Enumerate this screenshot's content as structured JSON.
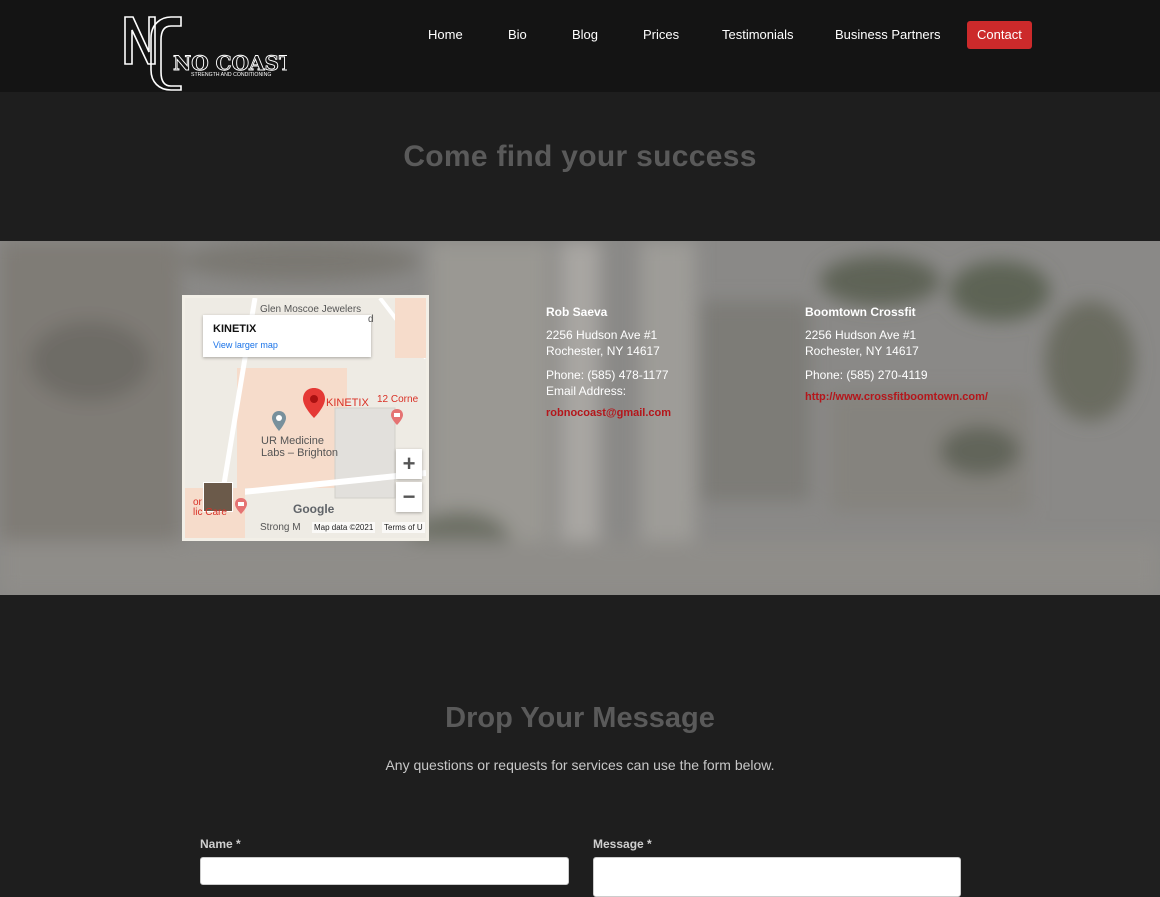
{
  "header": {
    "logo": {
      "big_letters": "NC",
      "word": "NO COAST",
      "tagline": "STRENGTH AND CONDITIONING"
    },
    "nav": [
      {
        "label": "Home"
      },
      {
        "label": "Bio"
      },
      {
        "label": "Blog"
      },
      {
        "label": "Prices"
      },
      {
        "label": "Testimonials"
      },
      {
        "label": "Business Partners"
      },
      {
        "label": "Contact"
      }
    ]
  },
  "hero": {
    "title": "Come find your success"
  },
  "map": {
    "place_name": "KINETIX",
    "view_larger": "View larger map",
    "marker_label": "KINETIX",
    "labels": {
      "top": "Glen Moscoe Jewelers",
      "top_suffix": "d",
      "corner": "12 Corne",
      "ur_medicine": "UR Medicine",
      "labs": "Labs – Brighton",
      "left_clip1": "or",
      "left_clip2": "lic Care",
      "strong": "Strong M",
      "google": "Google",
      "map_data": "Map data ©2021",
      "terms": "Terms of U"
    },
    "zoom_in": "+",
    "zoom_out": "−"
  },
  "contacts": [
    {
      "name": "Rob Saeva",
      "address1": "2256 Hudson Ave #1",
      "address2": "Rochester, NY 14617",
      "phone": "Phone: (585) 478-1177",
      "email_label": "Email Address:",
      "email": "robnocoast@gmail.com"
    },
    {
      "name": "Boomtown Crossfit",
      "address1": "2256 Hudson Ave #1",
      "address2": "Rochester, NY 14617",
      "phone": "Phone: (585) 270-4119",
      "website": "http://www.crossfitboomtown.com/"
    }
  ],
  "message": {
    "title": "Drop Your Message",
    "subtitle": "Any questions or requests for services can use the form below.",
    "name_label": "Name *",
    "message_label": "Message *"
  },
  "colors": {
    "accent": "#cc2a2b",
    "link_red": "#b4161b",
    "header_bg": "#141414",
    "page_bg": "#1e1e1e"
  }
}
